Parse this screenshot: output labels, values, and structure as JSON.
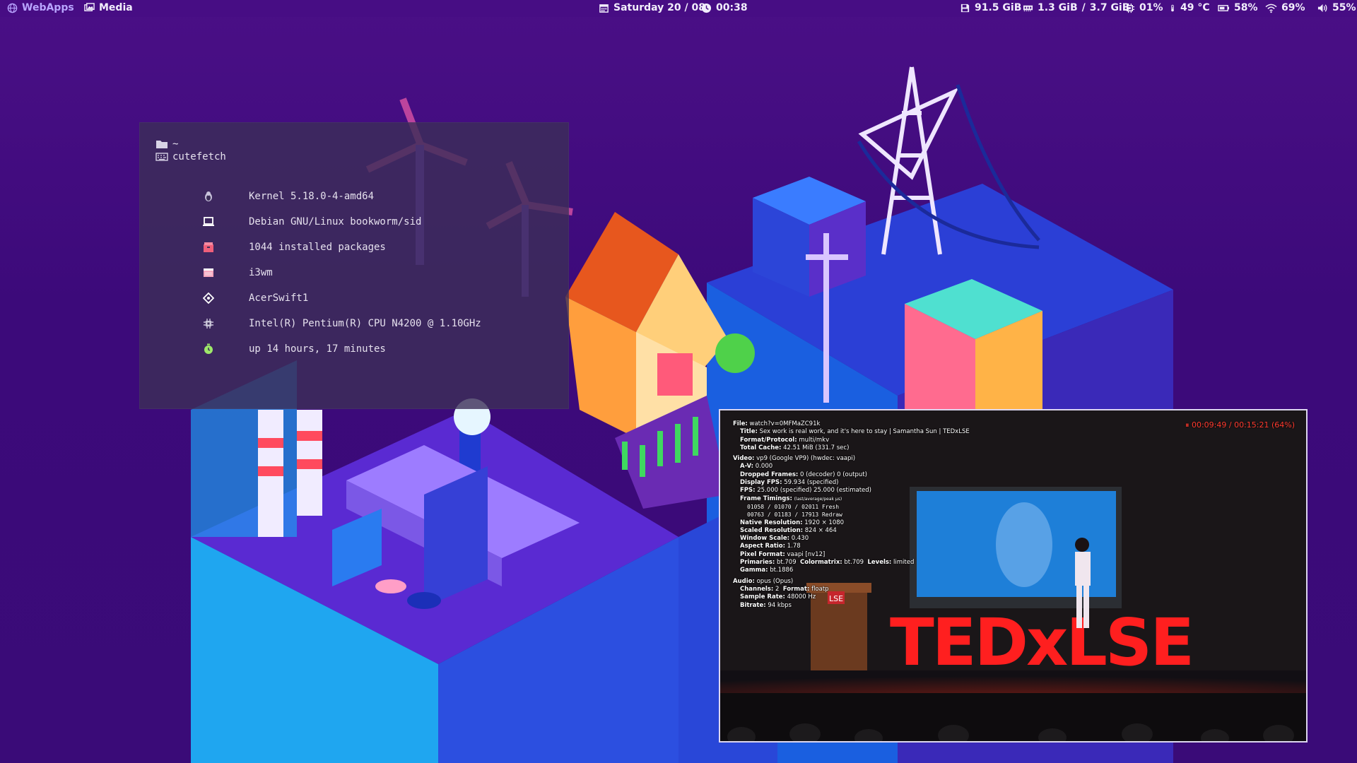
{
  "topbar": {
    "workspaces": [
      {
        "label": "WebApps",
        "icon": "globe-icon",
        "active": true
      },
      {
        "label": "Media",
        "icon": "images-icon",
        "active": false
      }
    ],
    "date": "Saturday 20 / 08",
    "time": "00:38",
    "disk": "91.5 GiB",
    "memory_used": "1.3 GiB",
    "memory_sep": "/",
    "memory_total": "3.7 GiB",
    "cpu": "01%",
    "temperature": "49 °C",
    "battery": "58%",
    "wifi": "69%",
    "volume": "55%",
    "colors": {
      "bar_bg": "#470d84",
      "text": "#f2eefc",
      "active_ws": "#b9a5ff"
    }
  },
  "terminal": {
    "cwd": "~",
    "command": "cutefetch",
    "rows": [
      {
        "icon": "tux-icon",
        "text": "Kernel 5.18.0-4-amd64",
        "color": "#c9c3dc"
      },
      {
        "icon": "laptop-icon",
        "text": "Debian GNU/Linux bookworm/sid",
        "color": "#ffffff"
      },
      {
        "icon": "package-icon",
        "text": "1044 installed packages",
        "color": "#ef5f7a"
      },
      {
        "icon": "window-icon",
        "text": "i3wm",
        "color": "#f7a6bd"
      },
      {
        "icon": "network-icon",
        "text": "AcerSwift1",
        "color": "#ffffff"
      },
      {
        "icon": "cpu-icon",
        "text": "Intel(R) Pentium(R) CPU N4200 @ 1.10GHz",
        "color": "#c7c2d6"
      },
      {
        "icon": "stopwatch-icon",
        "text": "up 14 hours, 17 minutes",
        "color": "#9ee86a"
      }
    ]
  },
  "player": {
    "playback": "⏸ 00:09:49 / 00:15:21 (64%)",
    "progress_percent": 64,
    "stats": {
      "file": "watch?v=0MFMaZC91k",
      "title": "Sex work is real work, and it's here to stay | Samantha Sun | TEDxLSE",
      "format": "multi/mkv",
      "cache": "42.51 MiB (331.7 sec)",
      "video": "vp9 (Google VP9) (hwdec: vaapi)",
      "av": "0.000",
      "dropped": "0 (decoder) 0 (output)",
      "display_fps": "59.934 (specified)",
      "fps": "25.000 (specified) 25.000 (estimated)",
      "timings_head": "(last/average/peak μs)",
      "timing_fresh": "01058 / 01070 / 02011    Fresh",
      "timing_redraw": "00763 / 01183 / 17913    Redraw",
      "native_res": "1920 × 1080",
      "scaled_res": "824 × 464",
      "window_scale": "0.430",
      "aspect": "1.78",
      "pixel_format": "vaapi [nv12]",
      "primaries": "bt.709",
      "colormatrix": "bt.709",
      "levels": "limited",
      "gamma": "bt.1886",
      "audio": "opus (Opus)",
      "channels": "2",
      "audio_format": "floatp",
      "sample_rate": "48000 Hz",
      "bitrate": "94 kbps"
    },
    "labels": {
      "file": "File:",
      "title": "Title:",
      "format": "Format/Protocol:",
      "cache": "Total Cache:",
      "video": "Video:",
      "av": "A-V:",
      "dropped": "Dropped Frames:",
      "display_fps": "Display FPS:",
      "fps": "FPS:",
      "timings": "Frame Timings:",
      "native_res": "Native Resolution:",
      "scaled_res": "Scaled Resolution:",
      "window_scale": "Window Scale:",
      "aspect": "Aspect Ratio:",
      "pixel_format": "Pixel Format:",
      "primaries": "Primaries:",
      "colormatrix": "Colormatrix:",
      "levels": "Levels:",
      "gamma": "Gamma:",
      "audio": "Audio:",
      "channels": "Channels:",
      "audio_format": "Format:",
      "sample_rate": "Sample Rate:",
      "bitrate": "Bitrate:"
    },
    "stage_sign": "TEDxLSE",
    "podium_logo": "LSE"
  }
}
